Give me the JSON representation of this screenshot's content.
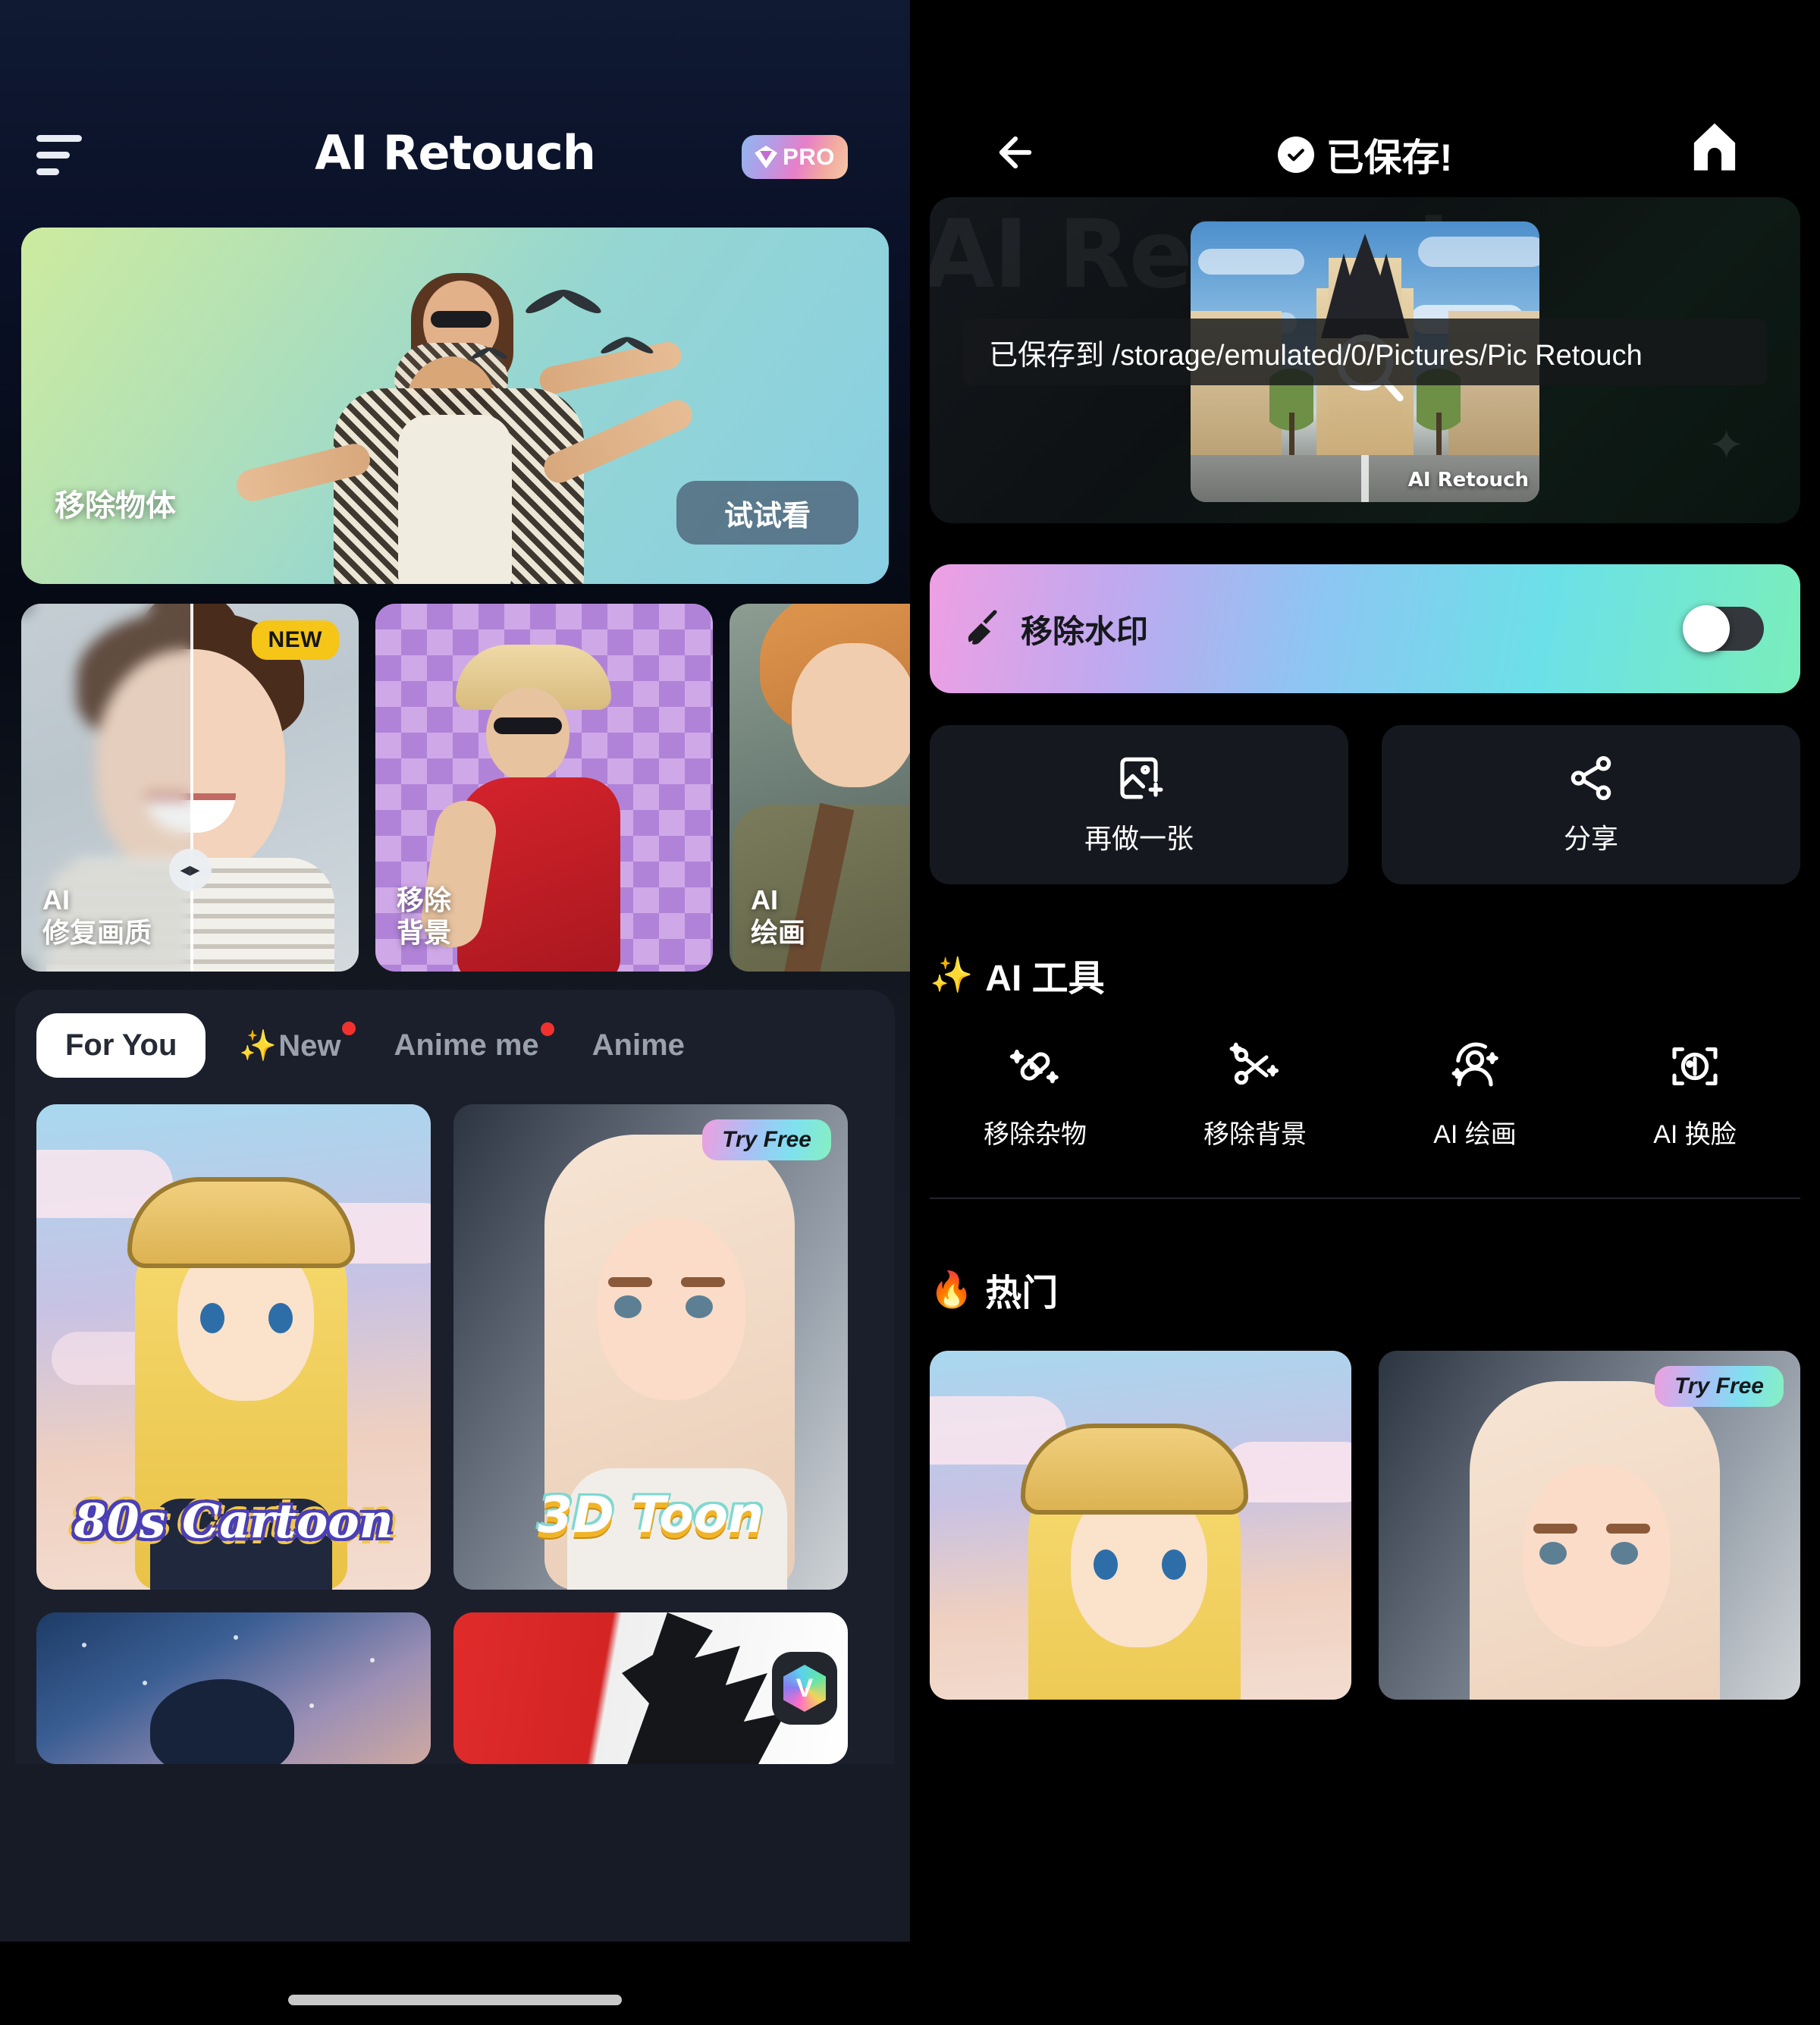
{
  "left": {
    "header": {
      "menu_icon": "hamburger-menu-icon",
      "app_title": "AI Retouch",
      "pro_badge": "PRO"
    },
    "hero": {
      "label": "移除物体",
      "cta": "试试看"
    },
    "feature_cards": [
      {
        "title_line1": "AI",
        "title_line2": "修复画质",
        "badge": "NEW"
      },
      {
        "title_line1": "移除",
        "title_line2": "背景",
        "badge": ""
      },
      {
        "title_line1": "AI",
        "title_line2": "绘画",
        "badge": ""
      }
    ],
    "tabs": [
      {
        "label": "For You",
        "active": true,
        "dot": false,
        "sparkle": false
      },
      {
        "label": "New",
        "active": false,
        "dot": true,
        "sparkle": true
      },
      {
        "label": "Anime me",
        "active": false,
        "dot": true,
        "sparkle": false
      },
      {
        "label": "Anime",
        "active": false,
        "dot": false,
        "sparkle": false
      }
    ],
    "gallery": [
      {
        "title": "80s Cartoon",
        "badge": ""
      },
      {
        "title": "3D Toon",
        "badge": "Try Free"
      }
    ]
  },
  "right": {
    "header": {
      "back_icon": "arrow-left-icon",
      "title": "已保存!",
      "check_icon": "check-circle-icon",
      "home_icon": "home-icon"
    },
    "preview": {
      "watermark_bg": "AI Retouch",
      "toast": "已保存到 /storage/emulated/0/Pictures/Pic Retouch",
      "photo_watermark": "AI Retouch",
      "zoom_icon": "magnifier-icon"
    },
    "watermark_bar": {
      "label": "移除水印",
      "icon": "broom-icon",
      "toggle_state": "off"
    },
    "actions": [
      {
        "label": "再做一张",
        "icon": "image-plus-icon"
      },
      {
        "label": "分享",
        "icon": "share-icon"
      }
    ],
    "ai_tools_section": {
      "emoji": "✨",
      "title": "AI 工具",
      "tools": [
        {
          "label": "移除杂物",
          "icon": "bandage-sparkle-icon"
        },
        {
          "label": "移除背景",
          "icon": "scissors-sparkle-icon"
        },
        {
          "label": "AI 绘画",
          "icon": "person-sparkle-icon"
        },
        {
          "label": "AI 换脸",
          "icon": "face-scan-icon"
        }
      ]
    },
    "hot_section": {
      "emoji": "🔥",
      "title": "热门",
      "cards": [
        {
          "badge": ""
        },
        {
          "badge": "Try Free"
        }
      ]
    }
  },
  "colors": {
    "accent_gradient_start": "#ef9fe3",
    "accent_gradient_mid": "#8cc6f2",
    "accent_gradient_end": "#79eebb",
    "badge_yellow": "#f5c518",
    "dot_red": "#f0322e",
    "panel_dark": "#15181f"
  }
}
